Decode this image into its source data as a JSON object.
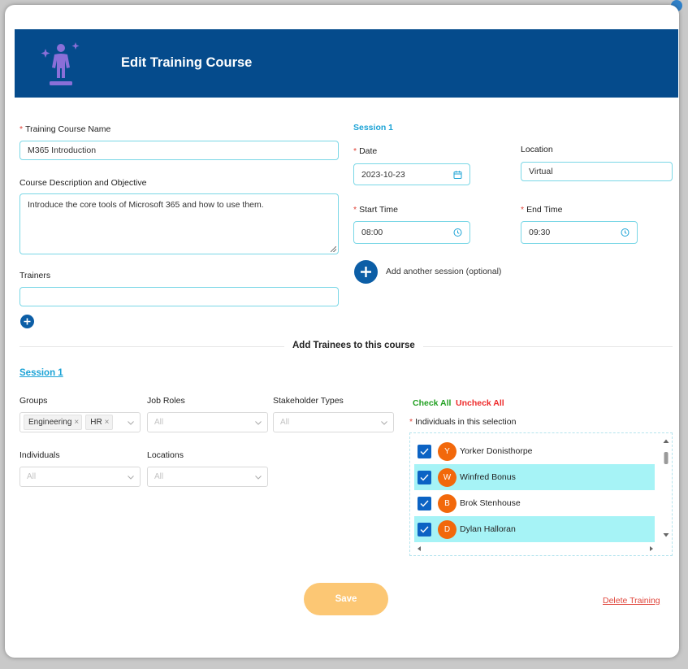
{
  "header": {
    "title": "Edit Training Course",
    "icon": "person-sparkle-icon"
  },
  "form": {
    "course_name": {
      "label": "Training Course Name",
      "value": "M365 Introduction",
      "required": true
    },
    "description": {
      "label": "Course Description and Objective",
      "value": "Introduce the core tools of Microsoft 365 and how to use them."
    },
    "trainers": {
      "label": "Trainers",
      "value": ""
    }
  },
  "session": {
    "title": "Session 1",
    "date": {
      "label": "Date",
      "value": "2023-10-23",
      "icon": "calendar-icon"
    },
    "location": {
      "label": "Location",
      "value": "Virtual"
    },
    "start_time": {
      "label": "Start Time",
      "value": "08:00",
      "icon": "clock-icon"
    },
    "end_time": {
      "label": "End Time",
      "value": "09:30",
      "icon": "clock-icon"
    },
    "add_session_label": "Add another session (optional)"
  },
  "trainees": {
    "section_title": "Add Trainees to this course",
    "session_link": "Session 1",
    "filters": {
      "groups": {
        "label": "Groups",
        "tags": [
          "Engineering",
          "HR"
        ]
      },
      "job_roles": {
        "label": "Job Roles",
        "placeholder": "All"
      },
      "stakeholder_types": {
        "label": "Stakeholder Types",
        "placeholder": "All"
      },
      "individuals": {
        "label": "Individuals",
        "placeholder": "All"
      },
      "locations": {
        "label": "Locations",
        "placeholder": "All"
      }
    },
    "check_all": "Check All",
    "uncheck_all": "Uncheck All",
    "list_label": "Individuals in this selection",
    "individuals": [
      {
        "initial": "Y",
        "name": "Yorker Donisthorpe",
        "checked": true,
        "highlighted": false
      },
      {
        "initial": "W",
        "name": "Winfred Bonus",
        "checked": true,
        "highlighted": true
      },
      {
        "initial": "B",
        "name": "Brok Stenhouse",
        "checked": true,
        "highlighted": false
      },
      {
        "initial": "D",
        "name": "Dylan Halloran",
        "checked": true,
        "highlighted": true
      }
    ]
  },
  "actions": {
    "save": "Save",
    "delete": "Delete Training"
  },
  "colors": {
    "header_bg": "#054b8c",
    "accent_cyan": "#1ca3d6",
    "primary_blue": "#0c5ea6",
    "avatar_orange": "#f2680b",
    "highlight_row": "#a6f3f6",
    "save_button": "#fcc774",
    "check_all": "#22a022",
    "uncheck_all": "#ee2a2a"
  }
}
